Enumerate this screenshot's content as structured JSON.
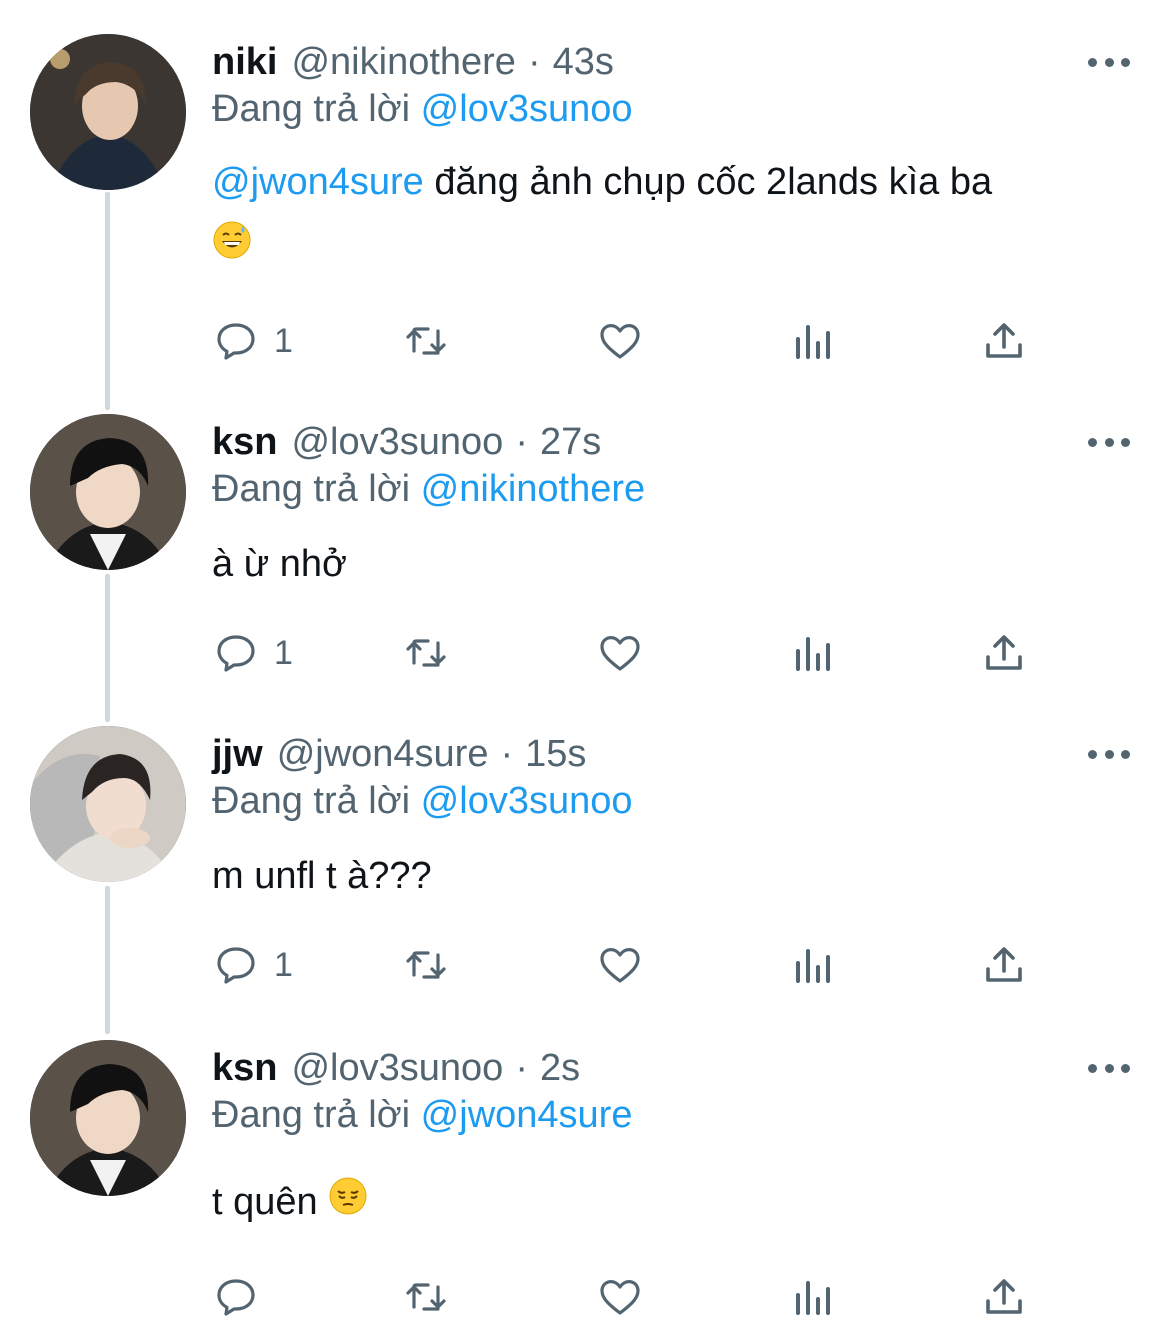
{
  "tweets": [
    {
      "name": "niki",
      "handle": "@nikinothere",
      "dot": "·",
      "time": "43s",
      "reply_prefix": "Đang trả lời",
      "reply_to": "@lov3sunoo",
      "mention": "@jwon4sure",
      "text": " đăng ảnh chụp cốc 2lands kìa ba",
      "emoji": "sweat-smile-emoji",
      "reply_count": "1"
    },
    {
      "name": "ksn",
      "handle": "@lov3sunoo",
      "dot": "·",
      "time": "27s",
      "reply_prefix": "Đang trả lời",
      "reply_to": "@nikinothere",
      "text": "à ừ nhở",
      "reply_count": "1"
    },
    {
      "name": "jjw",
      "handle": "@jwon4sure",
      "dot": "·",
      "time": "15s",
      "reply_prefix": "Đang trả lời",
      "reply_to": "@lov3sunoo",
      "text": "m unfl t à???",
      "reply_count": "1"
    },
    {
      "name": "ksn",
      "handle": "@lov3sunoo",
      "dot": "·",
      "time": "2s",
      "reply_prefix": "Đang trả lời",
      "reply_to": "@jwon4sure",
      "text": "t quên ",
      "emoji": "pensive-emoji",
      "reply_count": ""
    }
  ],
  "icons": {
    "reply": "reply-icon",
    "retweet": "retweet-icon",
    "like": "heart-icon",
    "views": "views-icon",
    "share": "share-icon",
    "more": "more-icon"
  },
  "colors": {
    "mention": "#1d9bf0",
    "secondary_text": "#536471",
    "primary_text": "#0f1419",
    "thread_line": "#cfd9de"
  }
}
